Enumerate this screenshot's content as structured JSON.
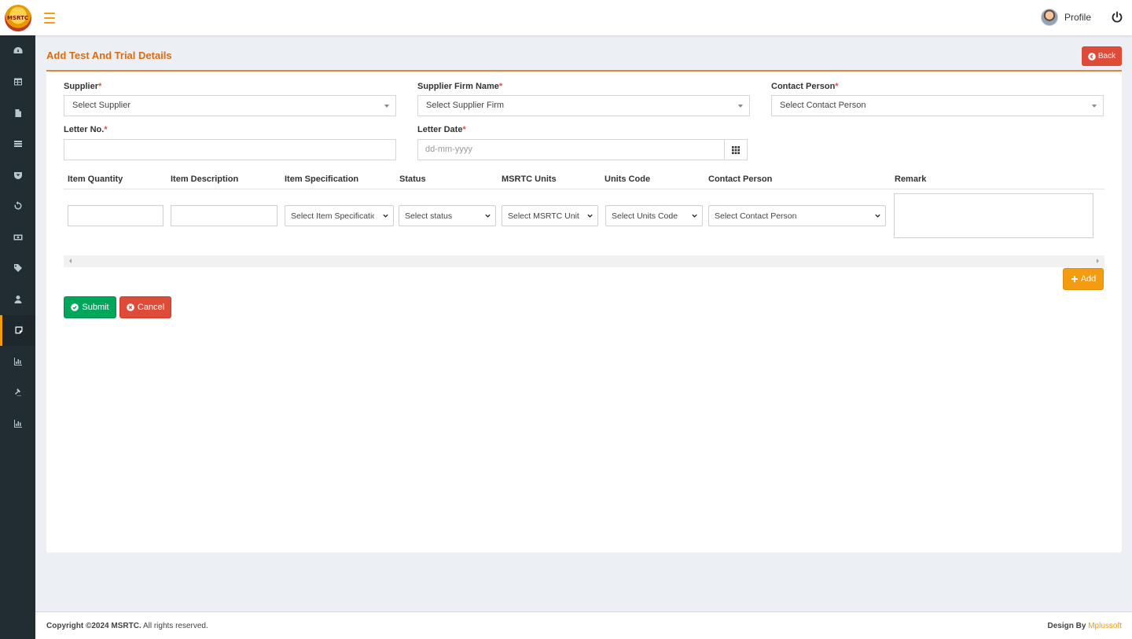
{
  "header": {
    "logo_text": "MSRTC",
    "profile_label": "Profile"
  },
  "sidebar": {
    "items": [
      {
        "icon": "dashboard-icon"
      },
      {
        "icon": "table-icon"
      },
      {
        "icon": "file-icon"
      },
      {
        "icon": "list-icon"
      },
      {
        "icon": "shield-icon"
      },
      {
        "icon": "refresh-icon"
      },
      {
        "icon": "money-icon"
      },
      {
        "icon": "tags-icon"
      },
      {
        "icon": "user-icon"
      },
      {
        "icon": "note-icon",
        "active": true
      },
      {
        "icon": "bar-chart-icon"
      },
      {
        "icon": "gavel-icon"
      },
      {
        "icon": "bar-chart-icon"
      }
    ]
  },
  "page": {
    "title": "Add Test And Trial Details",
    "back_label": "Back"
  },
  "form": {
    "supplier_label": "Supplier",
    "supplier_placeholder": "Select Supplier",
    "firm_label": "Supplier Firm Name",
    "firm_placeholder": "Select Supplier Firm",
    "contact_label": "Contact Person",
    "contact_placeholder": "Select Contact Person",
    "letter_no_label": "Letter No.",
    "letter_no_value": "",
    "letter_date_label": "Letter Date",
    "letter_date_placeholder": "dd-mm-yyyy",
    "required_mark": "*"
  },
  "items_table": {
    "headers": [
      "Item Quantity",
      "Item Description",
      "Item Specification",
      "Status",
      "MSRTC Units",
      "Units Code",
      "Contact Person",
      "Remark"
    ],
    "row": {
      "quantity": "",
      "description": "",
      "specification": "Select Item Specification",
      "status": "Select status",
      "msrtc_unit": "Select MSRTC Unit",
      "units_code": "Select Units Code",
      "contact_person": "Select Contact Person",
      "remark": ""
    },
    "add_label": "Add"
  },
  "actions": {
    "submit_label": "Submit",
    "cancel_label": "Cancel"
  },
  "footer": {
    "copyright_prefix": "Copyright ©2024 MSRTC.",
    "copyright_suffix": " All rights reserved.",
    "design_by": "Design By",
    "brand": "Mplussoft"
  },
  "colors": {
    "accent": "#f39c12",
    "title": "#dd6b10",
    "danger": "#dd4b39",
    "success": "#00a65a",
    "sidebar": "#222d32"
  }
}
